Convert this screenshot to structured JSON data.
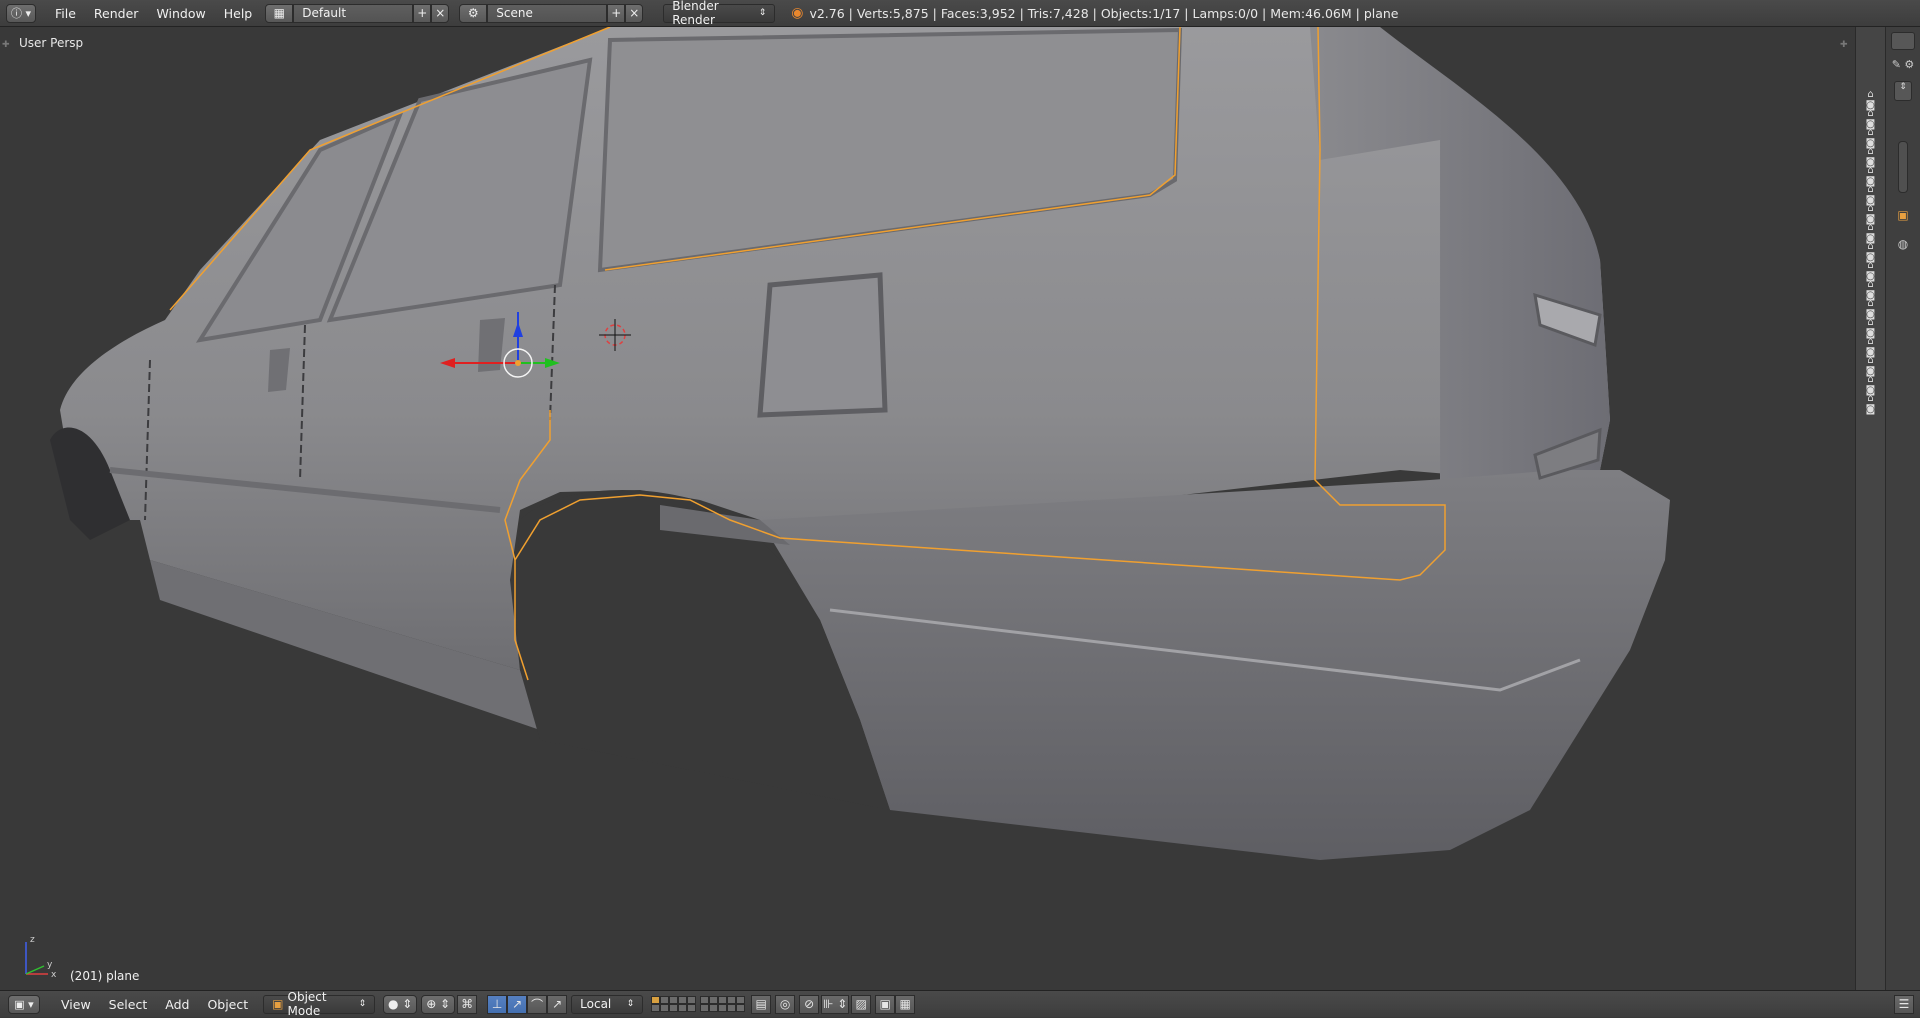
{
  "topbar": {
    "menus": [
      "File",
      "Render",
      "Window",
      "Help"
    ],
    "layout_name": "Default",
    "scene_name": "Scene",
    "render_engine": "Blender Render",
    "stats": "v2.76 | Verts:5,875 | Faces:3,952 | Tris:7,428 | Objects:1/17 | Lamps:0/0 | Mem:46.06M | plane"
  },
  "viewport": {
    "view_label": "User Persp",
    "object_label": "(201) plane",
    "gizmo_axes": {
      "x": "x",
      "y": "y",
      "z": "z"
    }
  },
  "bottombar": {
    "menus": [
      "View",
      "Select",
      "Add",
      "Object"
    ],
    "mode": "Object Mode",
    "orientation": "Local"
  },
  "colors": {
    "selection_outline": "#f0a030",
    "mesh": "#8c8c8f",
    "background": "#393939",
    "x_axis": "#e02020",
    "y_axis": "#20c020",
    "z_axis": "#2040e0"
  }
}
